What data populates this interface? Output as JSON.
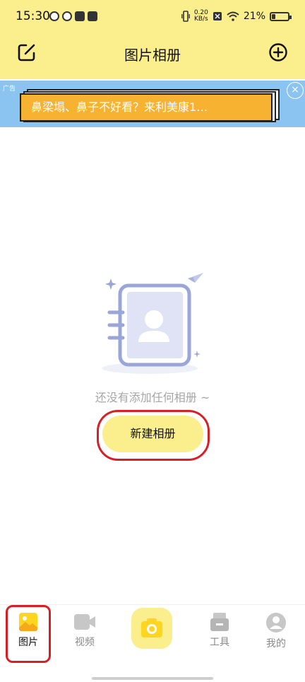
{
  "status": {
    "time": "15:30",
    "speed_value": "0.20",
    "speed_unit": "KB/s",
    "battery": "21%"
  },
  "header": {
    "title": "图片相册",
    "edit_icon": "edit-icon",
    "add_icon": "plus-circle-icon"
  },
  "ad": {
    "tag": "广告",
    "text": "鼻梁塌、鼻子不好看？来利美康1…",
    "close": "×"
  },
  "empty": {
    "message": "还没有添加任何相册 ~",
    "create_button": "新建相册"
  },
  "tabs": [
    {
      "label": "图片",
      "icon": "image-icon"
    },
    {
      "label": "视频",
      "icon": "video-icon"
    },
    {
      "label": "",
      "icon": "camera-icon"
    },
    {
      "label": "工具",
      "icon": "toolbox-icon"
    },
    {
      "label": "我的",
      "icon": "user-icon"
    }
  ],
  "colors": {
    "accent": "#fbee8d",
    "highlight": "#d62026",
    "ad_bg": "#8cc4f1"
  }
}
